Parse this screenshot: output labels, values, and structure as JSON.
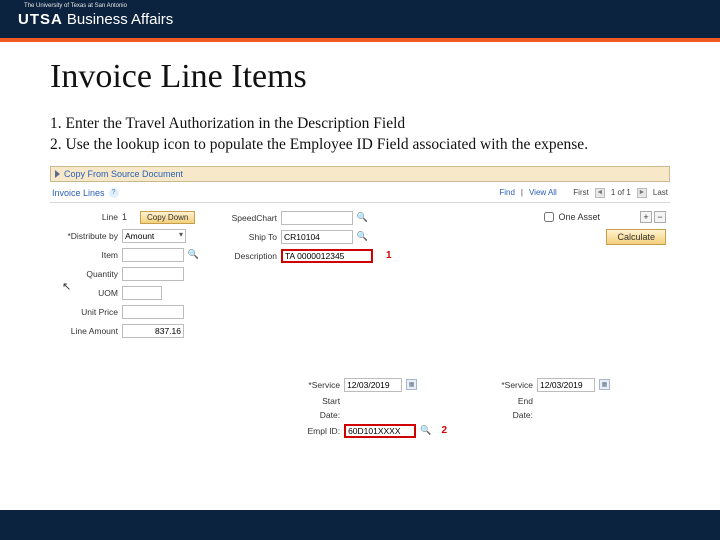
{
  "branding": {
    "university": "The University of Texas at San Antonio",
    "utsa": "UTSA",
    "dept": "Business Affairs"
  },
  "title": "Invoice Line Items",
  "instructions": {
    "i1": "1.  Enter the Travel Authorization in the Description Field",
    "i2": "2.  Use the lookup icon to populate the Employee ID Field associated with the expense."
  },
  "copybar": {
    "label": "Copy From Source Document"
  },
  "linesHeader": {
    "title": "Invoice Lines",
    "find": "Find",
    "viewAll": "View All",
    "first": "First",
    "pos": "1 of 1",
    "last": "Last"
  },
  "fields": {
    "lineLbl": "Line",
    "lineVal": "1",
    "copyDown": "Copy Down",
    "distributeLbl": "*Distribute by",
    "distributeVal": "Amount",
    "itemLbl": "Item",
    "itemVal": "",
    "quantityLbl": "Quantity",
    "quantityVal": "",
    "uomLbl": "UOM",
    "uomVal": "",
    "unitPriceLbl": "Unit Price",
    "unitPriceVal": "",
    "lineAmountLbl": "Line Amount",
    "lineAmountVal": "837.16",
    "speedChartLbl": "SpeedChart",
    "speedChartVal": "",
    "shipToLbl": "Ship To",
    "shipToVal": "CR10104",
    "descriptionLbl": "Description",
    "descriptionVal": "TA 0000012345",
    "oneAsset": "One Asset",
    "calculate": "Calculate"
  },
  "callouts": {
    "c1": "1",
    "c2": "2"
  },
  "service": {
    "svcLbl": "*Service",
    "date": "12/03/2019",
    "startLbl": "Start",
    "endLbl": "End",
    "dateLbl": "Date:",
    "emplLbl": "Empl ID:",
    "emplVal": "60D101XXXX"
  }
}
